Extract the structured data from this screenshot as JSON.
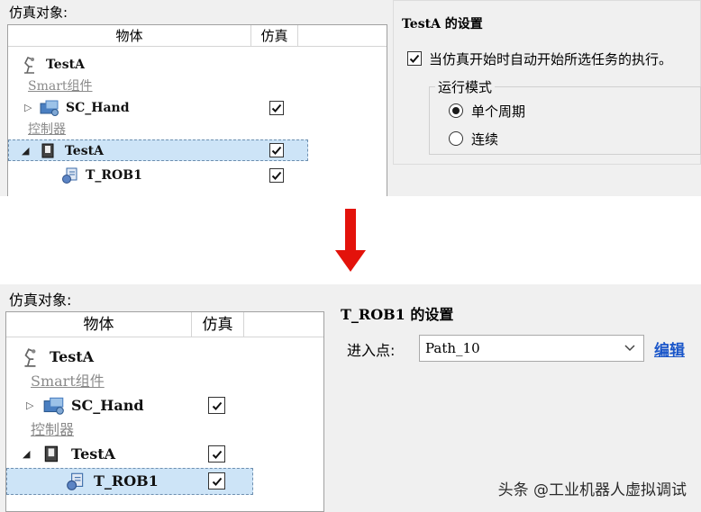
{
  "top": {
    "sim_objects_label": "仿真对象:",
    "columns": {
      "object": "物体",
      "simulate": "仿真"
    },
    "tree": {
      "station": "TestA",
      "smart_group": "Smart组件",
      "sc_hand": "SC_Hand",
      "controller_group": "控制器",
      "controller": "TestA",
      "task": "T_ROB1"
    },
    "checks": {
      "sc_hand": true,
      "controller": true,
      "task": true
    },
    "settings": {
      "title_name": "TestA",
      "title_suffix": " 的设置",
      "auto_start_label": "当仿真开始时自动开始所选任务的执行。",
      "auto_start_checked": true,
      "run_mode_title": "运行模式",
      "modes": [
        "单个周期",
        "连续"
      ],
      "selected_mode": "单个周期"
    }
  },
  "bottom": {
    "sim_objects_label": "仿真对象:",
    "columns": {
      "object": "物体",
      "simulate": "仿真"
    },
    "tree": {
      "station": "TestA",
      "smart_group": "Smart组件",
      "sc_hand": "SC_Hand",
      "controller_group": "控制器",
      "controller": "TestA",
      "task": "T_ROB1"
    },
    "checks": {
      "sc_hand": true,
      "controller": true,
      "task": true
    },
    "settings": {
      "title_name": "T_ROB1",
      "title_suffix": " 的设置",
      "entry_point_label": "进入点:",
      "entry_point_value": "Path_10",
      "edit_link": "编辑"
    }
  },
  "watermark": "头条 @工业机器人虚拟调试",
  "colors": {
    "arrow": "#e3120b",
    "selection": "#cde4f7",
    "link": "#1a56c9"
  },
  "icons": [
    "robot-icon",
    "smart-component-icon",
    "controller-icon",
    "task-icon",
    "checkmark-icon",
    "down-arrow-icon",
    "chevron-down-icon"
  ]
}
